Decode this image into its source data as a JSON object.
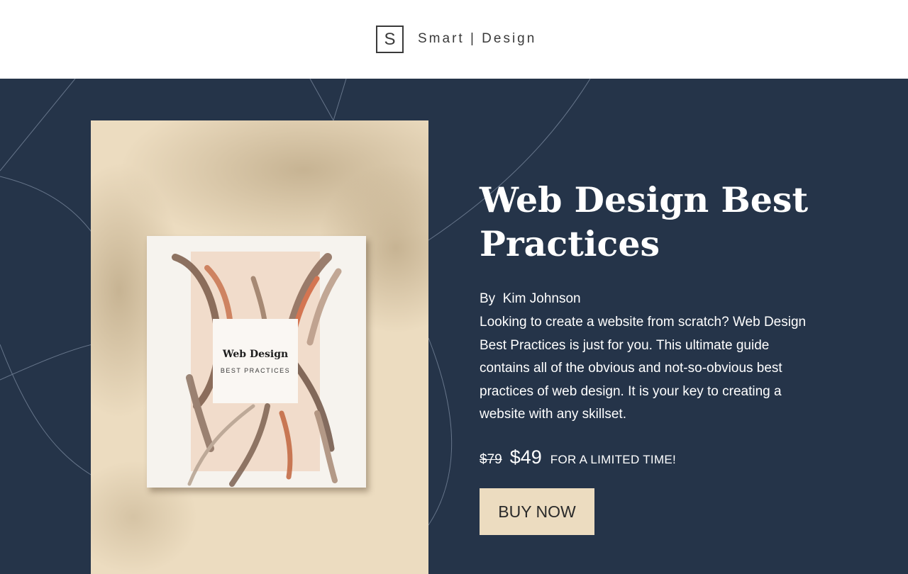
{
  "header": {
    "logo_letter": "S",
    "brand": "Smart | Design"
  },
  "product": {
    "title": "Web Design Best Practices",
    "author_prefix": "By",
    "author": "Kim Johnson",
    "description": "Looking to create a website from scratch? Web Design Best Practices is just for you. This ultimate guide contains all of the obvious and not-so-obvious best practices of web design. It is your key to creating a website with any skillset.",
    "price_old": "$79",
    "price_new": "$49",
    "price_note": "FOR A LIMITED TIME!",
    "buy_label": "BUY NOW",
    "cover": {
      "title": "Web Design",
      "subtitle": "BEST PRACTICES"
    }
  },
  "colors": {
    "hero_bg": "#253449",
    "accent": "#ecdcc0",
    "text_light": "#ffffff",
    "text_dark": "#3a3a3a"
  }
}
